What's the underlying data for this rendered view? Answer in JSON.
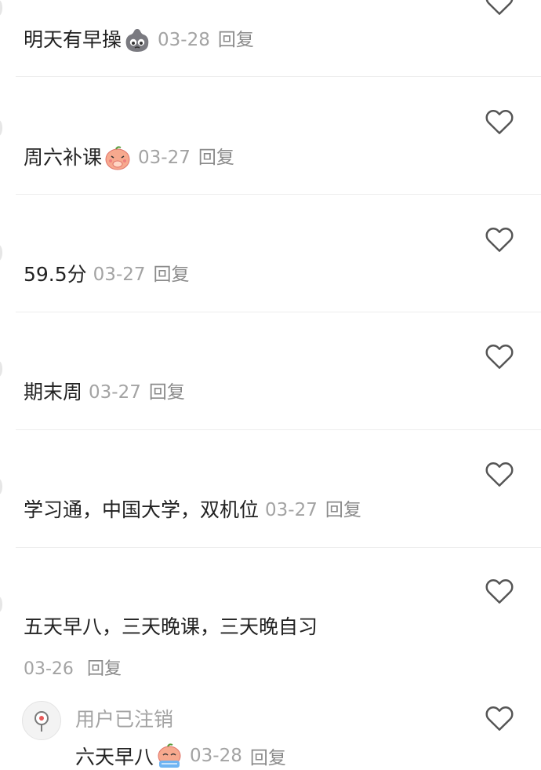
{
  "comments": [
    {
      "text": "明天有早操",
      "emoji_icon": "gray-blob-emoji-icon",
      "date": "03-28",
      "reply_label": "回复"
    },
    {
      "text": "周六补课",
      "emoji_icon": "peach-covering-mouth-emoji-icon",
      "date": "03-27",
      "reply_label": "回复"
    },
    {
      "text": "59.5分",
      "date": "03-27",
      "reply_label": "回复"
    },
    {
      "text": "期末周",
      "date": "03-27",
      "reply_label": "回复"
    },
    {
      "text": "学习通，中国大学，双机位",
      "date": "03-27",
      "reply_label": "回复"
    },
    {
      "text": "五天早八，三天晚课，三天晚自习",
      "date": "03-26",
      "reply_label": "回复"
    }
  ],
  "sub_reply": {
    "user_name": "用户已注销",
    "text": "六天早八",
    "emoji_icon": "peach-crying-emoji-icon",
    "date": "03-28",
    "reply_label": "回复"
  },
  "icons": {
    "like": "heart-outline-icon",
    "avatar": "deleted-user-avatar-icon"
  },
  "colors": {
    "text": "#222222",
    "meta": "#a3a3a3",
    "divider": "#ededed",
    "background": "#ffffff"
  }
}
